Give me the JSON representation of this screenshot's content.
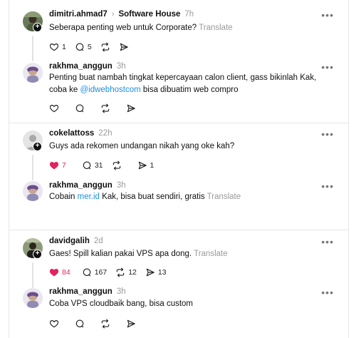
{
  "threads": [
    {
      "post": {
        "username": "dimitri.ahmad7",
        "community": "Software House",
        "time": "7h",
        "text": "Seberapa penting web untuk Corporate?",
        "translate": "Translate",
        "likes": "1",
        "replies": "5",
        "reposts": "",
        "shares": ""
      },
      "reply": {
        "username": "rakhma_anggun",
        "time": "3h",
        "text_before": "Penting buat nambah tingkat kepercayaan calon client, gass bikinlah Kak, coba ke ",
        "link": "@idwebhostcom",
        "text_after": " bisa dibuatim web compro"
      }
    },
    {
      "post": {
        "username": "cokelattoss",
        "time": "22h",
        "text": "Guys ada rekomen undangan nikah yang oke kah?",
        "likes": "7",
        "replies": "31",
        "reposts": "",
        "shares": "1"
      },
      "reply": {
        "username": "rakhma_anggun",
        "time": "3h",
        "text_before": "Cobain ",
        "link": "mer.id",
        "text_after": " Kak, bisa buat sendiri, gratis",
        "translate": "Translate"
      }
    },
    {
      "post": {
        "username": "davidgalih",
        "time": "2d",
        "text": "Gaes! Spill kalian pakai VPS apa dong.",
        "translate": "Translate",
        "likes": "84",
        "replies": "167",
        "reposts": "12",
        "shares": "13"
      },
      "reply": {
        "username": "rakhma_anggun",
        "time": "3h",
        "text": "Coba VPS cloudbaik bang, bisa custom"
      }
    }
  ],
  "colors": {
    "like": "#e0245e",
    "link": "#1d8fe0",
    "muted": "#9a9a9a"
  },
  "icons": [
    "heart-icon",
    "comment-icon",
    "repost-icon",
    "share-icon",
    "more-icon",
    "follow-plus-icon",
    "chevron-right-icon"
  ]
}
